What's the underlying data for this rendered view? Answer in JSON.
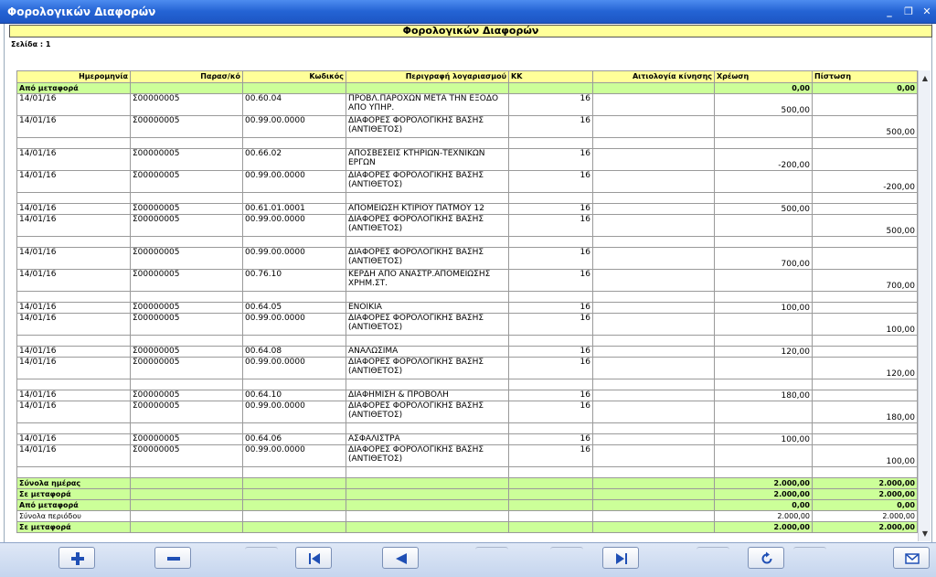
{
  "window": {
    "title": "Φορολογικών Διαφορών",
    "minimize": "_",
    "restore": "❐",
    "close": "✕"
  },
  "report": {
    "title": "Φορολογικών Διαφορών",
    "page_label": "Σελίδα : 1"
  },
  "columns": [
    "Ημερομηνία",
    "Παρασ/κό",
    "Κωδικός",
    "Περιγραφή λογαριασμού",
    "ΚΚ",
    "Αιτιολογία κίνησης",
    "Χρέωση",
    "Πίστωση"
  ],
  "carry_in": {
    "label": "Από μεταφορά",
    "debit": "0,00",
    "credit": "0,00"
  },
  "groups": [
    {
      "rows": [
        {
          "date": "14/01/16",
          "doc": "Σ00000005",
          "code": "00.60.04",
          "desc": "ΠΡΟΒΛ.ΠΑΡΟΧΩΝ ΜΕΤΑ ΤΗΝ ΕΞΟΔΟ ΑΠΟ ΥΠΗΡ.",
          "kk": "16",
          "reason": "",
          "debit": "500,00",
          "credit": ""
        },
        {
          "date": "14/01/16",
          "doc": "Σ00000005",
          "code": "00.99.00.0000",
          "desc": "ΔΙΑΦΟΡΕΣ ΦΟΡΟΛΟΓΙΚΗΣ ΒΑΣΗΣ (ΑΝΤΙΘΕΤΟΣ)",
          "kk": "16",
          "reason": "",
          "debit": "",
          "credit": "500,00"
        }
      ]
    },
    {
      "rows": [
        {
          "date": "14/01/16",
          "doc": "Σ00000005",
          "code": "00.66.02",
          "desc": "ΑΠΟΣΒΕΣΕΙΣ ΚΤΗΡΙΩΝ-ΤΕΧΝΙΚΩΝ ΕΡΓΩΝ",
          "kk": "16",
          "reason": "",
          "debit": "-200,00",
          "credit": ""
        },
        {
          "date": "14/01/16",
          "doc": "Σ00000005",
          "code": "00.99.00.0000",
          "desc": "ΔΙΑΦΟΡΕΣ ΦΟΡΟΛΟΓΙΚΗΣ ΒΑΣΗΣ (ΑΝΤΙΘΕΤΟΣ)",
          "kk": "16",
          "reason": "",
          "debit": "",
          "credit": "-200,00"
        }
      ]
    },
    {
      "rows": [
        {
          "date": "14/01/16",
          "doc": "Σ00000005",
          "code": "00.61.01.0001",
          "desc": "ΑΠΟΜΕΙΩΣΗ ΚΤΙΡΙΟΥ ΠΑΤΜΟΥ 12",
          "kk": "16",
          "reason": "",
          "debit": "500,00",
          "credit": ""
        },
        {
          "date": "14/01/16",
          "doc": "Σ00000005",
          "code": "00.99.00.0000",
          "desc": "ΔΙΑΦΟΡΕΣ ΦΟΡΟΛΟΓΙΚΗΣ ΒΑΣΗΣ (ΑΝΤΙΘΕΤΟΣ)",
          "kk": "16",
          "reason": "",
          "debit": "",
          "credit": "500,00"
        }
      ]
    },
    {
      "rows": [
        {
          "date": "14/01/16",
          "doc": "Σ00000005",
          "code": "00.99.00.0000",
          "desc": "ΔΙΑΦΟΡΕΣ ΦΟΡΟΛΟΓΙΚΗΣ ΒΑΣΗΣ (ΑΝΤΙΘΕΤΟΣ)",
          "kk": "16",
          "reason": "",
          "debit": "700,00",
          "credit": ""
        },
        {
          "date": "14/01/16",
          "doc": "Σ00000005",
          "code": "00.76.10",
          "desc": "ΚΕΡΔΗ ΑΠΟ ΑΝΑΣΤΡ.ΑΠΟΜΕΙΩΣΗΣ ΧΡΗΜ.ΣΤ.",
          "kk": "16",
          "reason": "",
          "debit": "",
          "credit": "700,00"
        }
      ]
    },
    {
      "rows": [
        {
          "date": "14/01/16",
          "doc": "Σ00000005",
          "code": "00.64.05",
          "desc": "ΕΝΟΙΚΙΑ",
          "kk": "16",
          "reason": "",
          "debit": "100,00",
          "credit": ""
        },
        {
          "date": "14/01/16",
          "doc": "Σ00000005",
          "code": "00.99.00.0000",
          "desc": "ΔΙΑΦΟΡΕΣ ΦΟΡΟΛΟΓΙΚΗΣ ΒΑΣΗΣ (ΑΝΤΙΘΕΤΟΣ)",
          "kk": "16",
          "reason": "",
          "debit": "",
          "credit": "100,00"
        }
      ]
    },
    {
      "rows": [
        {
          "date": "14/01/16",
          "doc": "Σ00000005",
          "code": "00.64.08",
          "desc": "ΑΝΑΛΩΣΙΜΑ",
          "kk": "16",
          "reason": "",
          "debit": "120,00",
          "credit": ""
        },
        {
          "date": "14/01/16",
          "doc": "Σ00000005",
          "code": "00.99.00.0000",
          "desc": "ΔΙΑΦΟΡΕΣ ΦΟΡΟΛΟΓΙΚΗΣ ΒΑΣΗΣ (ΑΝΤΙΘΕΤΟΣ)",
          "kk": "16",
          "reason": "",
          "debit": "",
          "credit": "120,00"
        }
      ]
    },
    {
      "rows": [
        {
          "date": "14/01/16",
          "doc": "Σ00000005",
          "code": "00.64.10",
          "desc": "ΔΙΑΦΗΜΙΣΗ & ΠΡΟΒΟΛΗ",
          "kk": "16",
          "reason": "",
          "debit": "180,00",
          "credit": ""
        },
        {
          "date": "14/01/16",
          "doc": "Σ00000005",
          "code": "00.99.00.0000",
          "desc": "ΔΙΑΦΟΡΕΣ ΦΟΡΟΛΟΓΙΚΗΣ ΒΑΣΗΣ (ΑΝΤΙΘΕΤΟΣ)",
          "kk": "16",
          "reason": "",
          "debit": "",
          "credit": "180,00"
        }
      ]
    },
    {
      "rows": [
        {
          "date": "14/01/16",
          "doc": "Σ00000005",
          "code": "00.64.06",
          "desc": "ΑΣΦΑΛΙΣΤΡΑ",
          "kk": "16",
          "reason": "",
          "debit": "100,00",
          "credit": ""
        },
        {
          "date": "14/01/16",
          "doc": "Σ00000005",
          "code": "00.99.00.0000",
          "desc": "ΔΙΑΦΟΡΕΣ ΦΟΡΟΛΟΓΙΚΗΣ ΒΑΣΗΣ (ΑΝΤΙΘΕΤΟΣ)",
          "kk": "16",
          "reason": "",
          "debit": "",
          "credit": "100,00"
        }
      ]
    }
  ],
  "totals": [
    {
      "label": "Σύνολα ημέρας",
      "debit": "2.000,00",
      "credit": "2.000,00",
      "style": "green"
    },
    {
      "label": "Σε μεταφορά",
      "debit": "2.000,00",
      "credit": "2.000,00",
      "style": "green"
    },
    {
      "label": "Από μεταφορά",
      "debit": "0,00",
      "credit": "0,00",
      "style": "green"
    },
    {
      "label": "Σύνολα περιόδου",
      "debit": "2.000,00",
      "credit": "2.000,00",
      "style": "plain"
    },
    {
      "label": "Σε μεταφορά",
      "debit": "2.000,00",
      "credit": "2.000,00",
      "style": "green"
    }
  ],
  "toolbar": {
    "add_icon": "plus-icon",
    "remove_icon": "minus-icon",
    "first_icon": "first-page-icon",
    "prev_icon": "previous-page-icon",
    "last_icon": "last-page-icon",
    "refresh_icon": "refresh-icon",
    "mail_icon": "mail-icon"
  },
  "colors": {
    "header_fill": "#ffff99",
    "totals_fill": "#ccff99",
    "titlebar": "#2463d4",
    "button_icon": "#1f4fb5"
  }
}
